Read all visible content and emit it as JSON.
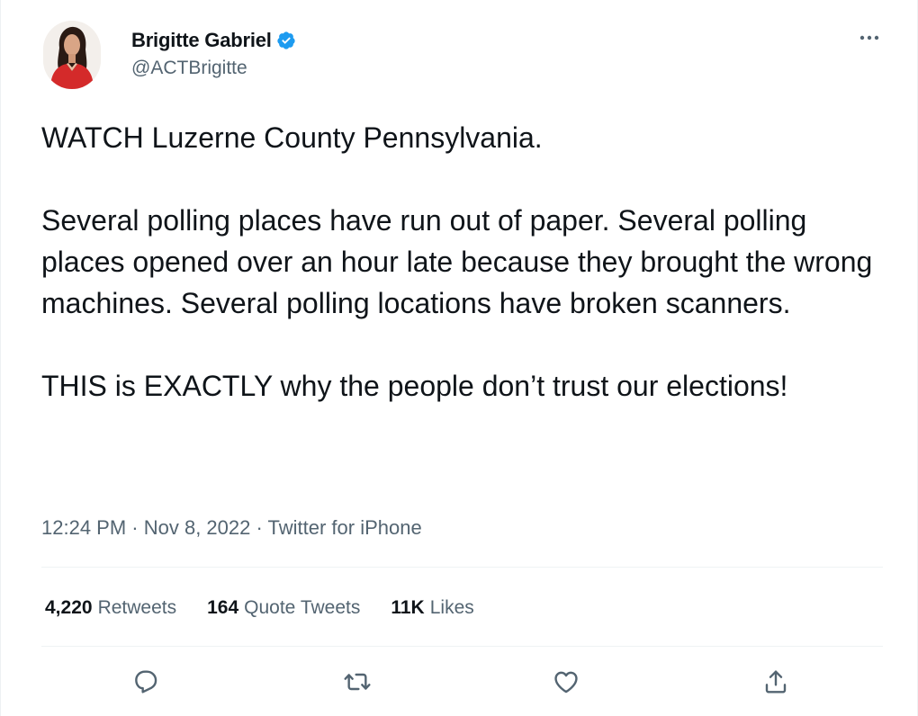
{
  "author": {
    "display_name": "Brigitte Gabriel",
    "handle": "@ACTBrigitte",
    "verified": true,
    "verified_color": "#1d9bf0"
  },
  "tweet": {
    "paragraphs": [
      "WATCH Luzerne County Pennsylvania.",
      "Several polling places have run out of paper. Several polling places opened over an hour late because they brought the wrong machines. Several polling locations have broken scanners.",
      "THIS is EXACTLY why the people don’t trust our elections!"
    ]
  },
  "meta": {
    "time": "12:24 PM",
    "separator": " · ",
    "date": "Nov 8, 2022",
    "source": "Twitter for iPhone"
  },
  "stats": {
    "retweets": {
      "count": "4,220",
      "label": "Retweets"
    },
    "quote_tweets": {
      "count": "164",
      "label": "Quote Tweets"
    },
    "likes": {
      "count": "11K",
      "label": "Likes"
    }
  },
  "icons": {
    "more": "more-horizontal-icon",
    "reply": "reply-icon",
    "retweet": "retweet-icon",
    "like": "heart-icon",
    "share": "share-icon"
  },
  "colors": {
    "text": "#0f1419",
    "secondary": "#536471",
    "divider": "#eff3f4",
    "avatar_dress": "#d42a2a"
  }
}
